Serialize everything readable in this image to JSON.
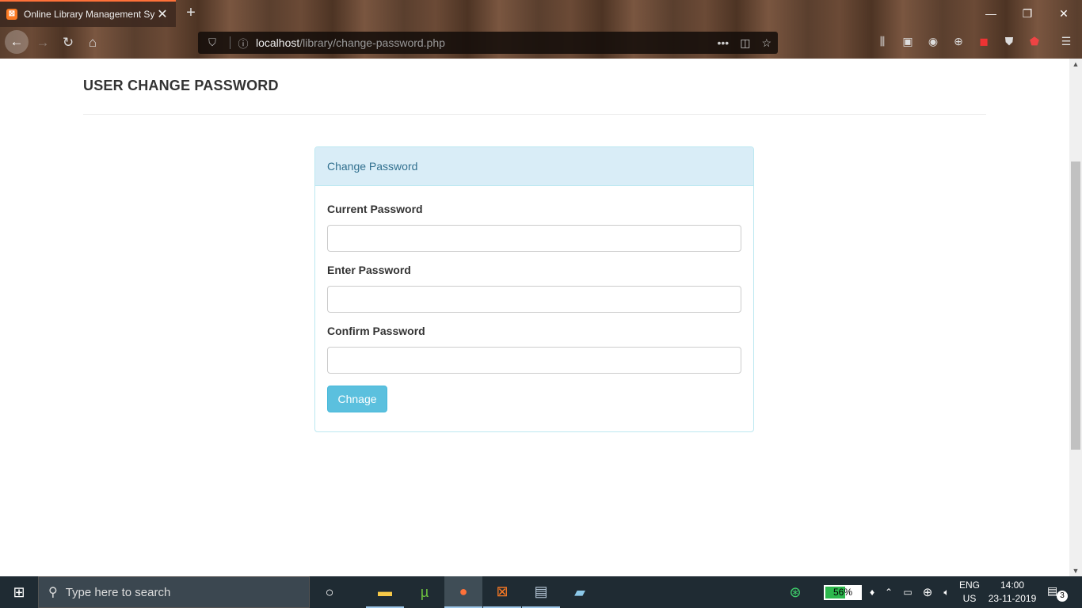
{
  "browser": {
    "tab_title": "Online Library Management Sy",
    "url_host": "localhost",
    "url_path": "/library/change-password.php",
    "more_label": "•••"
  },
  "page": {
    "heading": "USER CHANGE PASSWORD",
    "panel_title": "Change Password",
    "fields": [
      {
        "label": "Current Password",
        "value": ""
      },
      {
        "label": "Enter Password",
        "value": ""
      },
      {
        "label": "Confirm Password",
        "value": ""
      }
    ],
    "submit_label": "Chnage",
    "colors": {
      "panel_header_bg": "#d9edf7",
      "panel_header_text": "#31708f",
      "button_bg": "#5bc0de"
    }
  },
  "taskbar": {
    "search_placeholder": "Type here to search",
    "battery_percent": "56%",
    "battery_level": 0.56,
    "lang_line1": "ENG",
    "lang_line2": "US",
    "time": "14:00",
    "date": "23-11-2019",
    "notification_count": "3"
  }
}
